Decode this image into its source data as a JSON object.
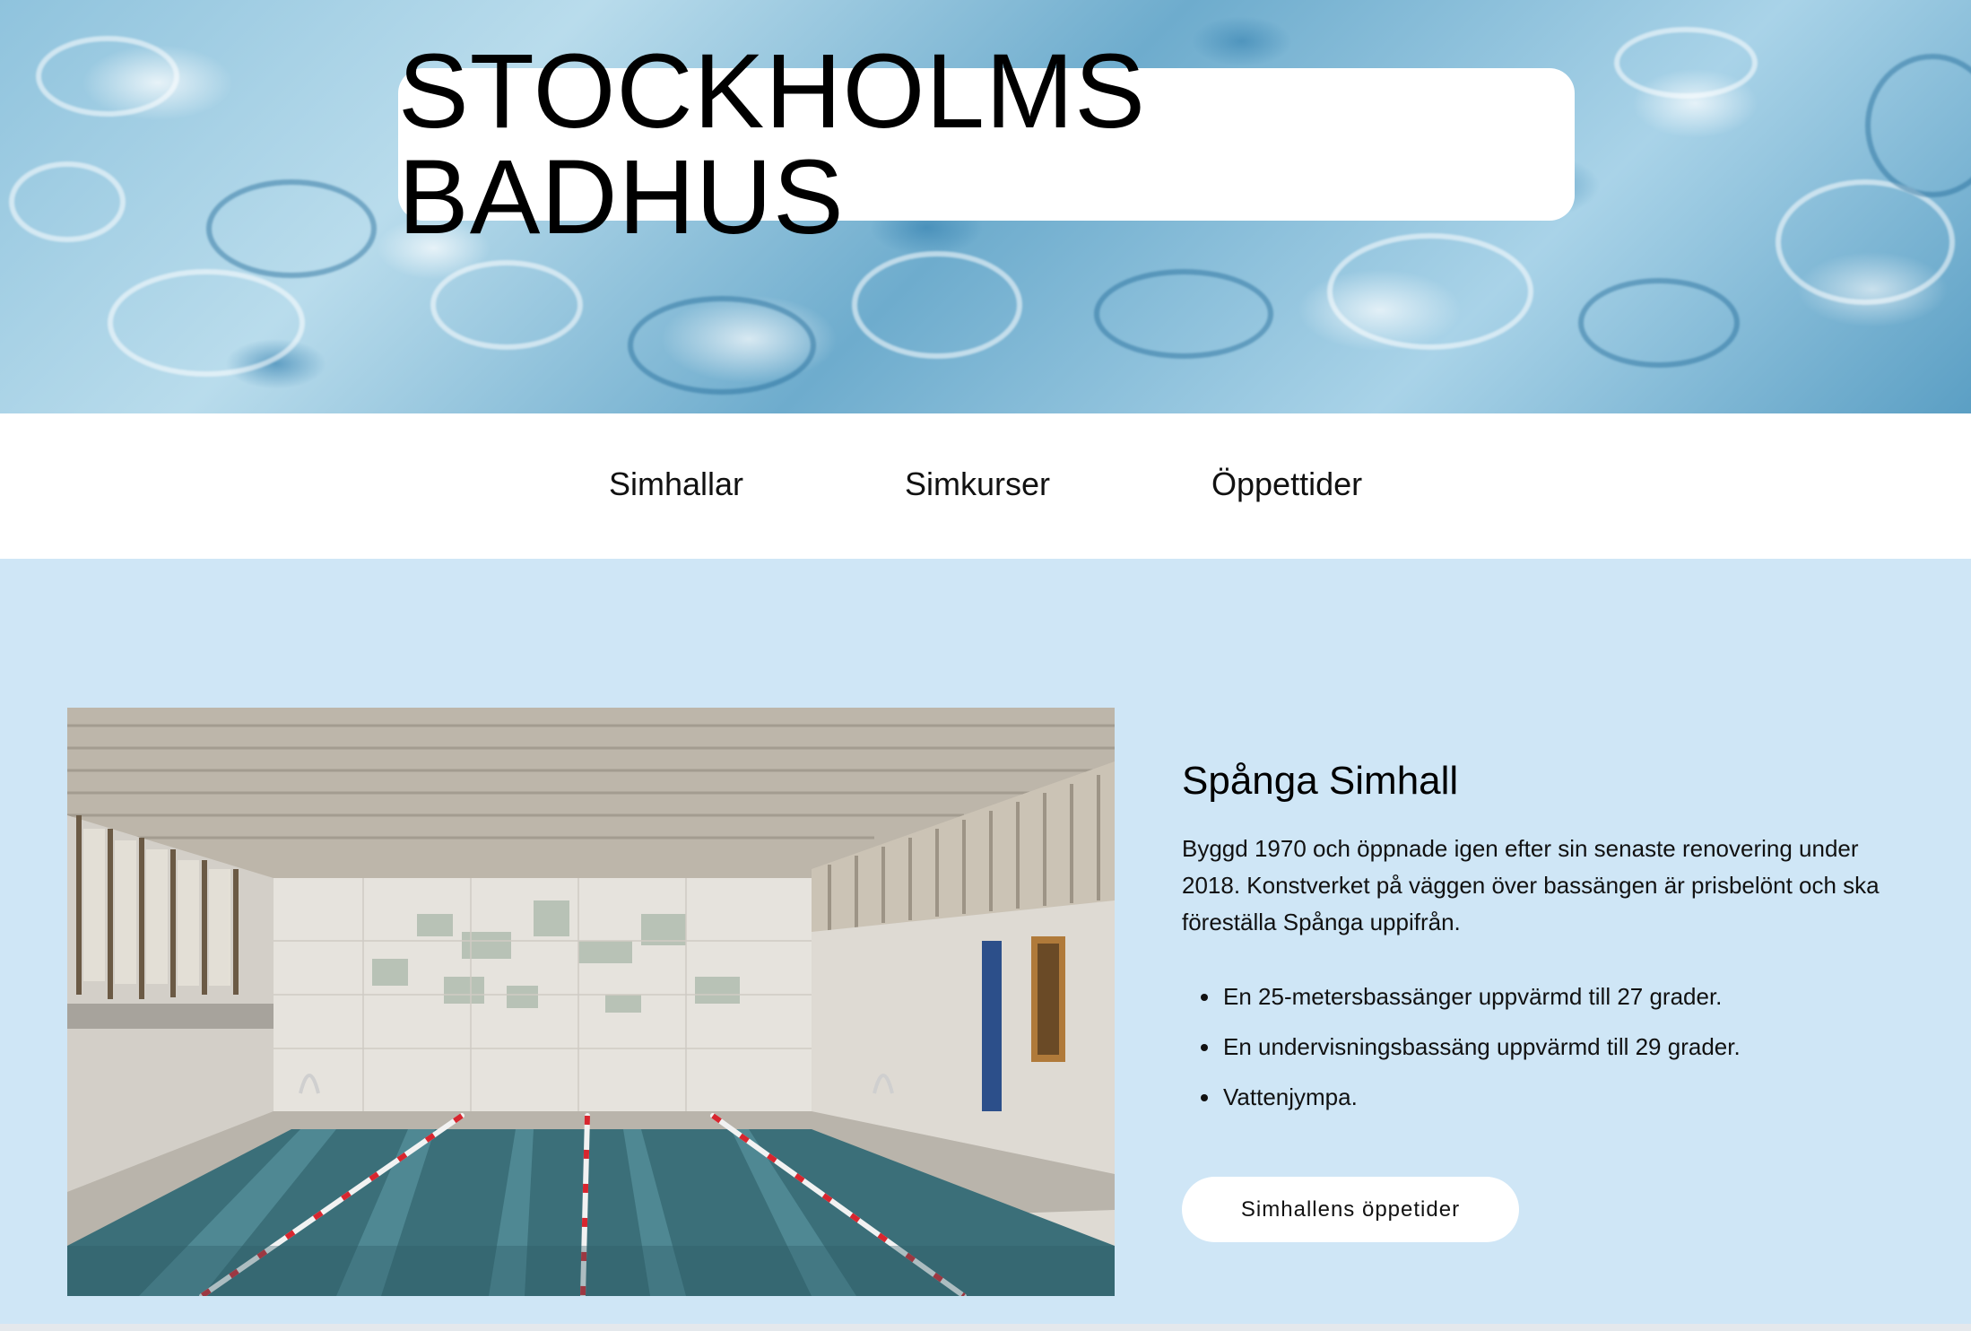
{
  "header": {
    "title": "STOCKHOLMS BADHUS"
  },
  "nav": {
    "items": [
      {
        "label": "Simhallar"
      },
      {
        "label": "Simkurser"
      },
      {
        "label": "Öppettider"
      }
    ]
  },
  "hall": {
    "name": "Spånga Simhall",
    "description": "Byggd 1970 och öppnade igen efter sin senaste renovering under 2018. Konstverket på väggen över bassängen är prisbelönt och ska föreställa Spånga uppifrån.",
    "facts": [
      "En 25-metersbassänger uppvärmd till 27 grader.",
      "En undervisningsbassäng uppvärmd till 29 grader.",
      "Vattenjympa."
    ],
    "button_label": "Simhallens öppetider"
  },
  "colors": {
    "content_background": "#cfe6f6",
    "nav_background": "#ffffff",
    "button_background": "#ffffff",
    "lane_rope_red": "#d8262f"
  }
}
